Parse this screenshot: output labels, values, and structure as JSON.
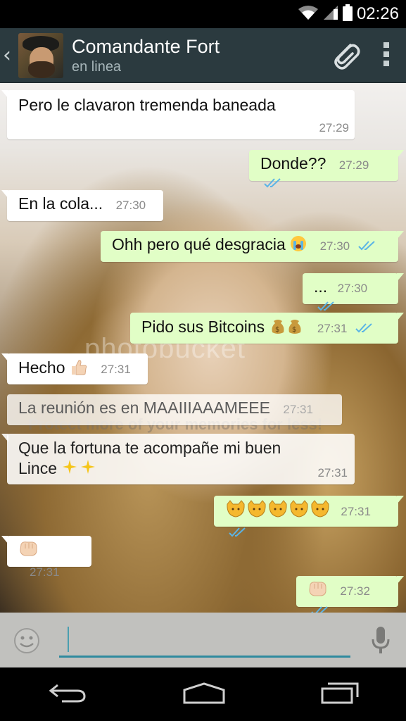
{
  "status_bar": {
    "time": "02:26"
  },
  "header": {
    "back": "‹",
    "contact_name": "Comandante Fort",
    "contact_status": "en linea"
  },
  "watermark": {
    "brand": "photobucket",
    "tagline": "Protect more of your memories for less!"
  },
  "messages": [
    {
      "dir": "in",
      "text": "Pero le clavaron tremenda baneada",
      "time": "27:29"
    },
    {
      "dir": "out",
      "text": "Donde??",
      "time": "27:29"
    },
    {
      "dir": "in",
      "text": "En la cola...",
      "time": "27:30"
    },
    {
      "dir": "out",
      "text": "Ohh pero qué desgracia",
      "emoji": "crying-face",
      "time": "27:30"
    },
    {
      "dir": "out",
      "text": "...",
      "time": "27:30"
    },
    {
      "dir": "out",
      "text": "Pido sus Bitcoins",
      "emoji": "money-bags",
      "time": "27:31"
    },
    {
      "dir": "in",
      "text": "Hecho",
      "emoji": "thumbs-up",
      "time": "27:31"
    },
    {
      "dir": "in",
      "text": "La reunión es en MAAIIIAAAMEEE",
      "time": "27:31"
    },
    {
      "dir": "in",
      "text": "Que la fortuna te acompañe mi buen",
      "text2": "Lince",
      "emoji": "sparkles",
      "time": "27:31"
    },
    {
      "dir": "out",
      "text": "",
      "emoji": "smiling-cat-faces",
      "time": "27:31"
    },
    {
      "dir": "in",
      "text": "",
      "emoji": "fist-bump",
      "time": "27:31"
    },
    {
      "dir": "out",
      "text": "",
      "emoji": "fist-bump",
      "time": "27:32"
    }
  ],
  "composer": {
    "value": "",
    "placeholder": ""
  },
  "icons": {
    "attach": "paperclip-icon",
    "menu": "overflow-menu-icon",
    "emoji": "smiley-icon",
    "mic": "microphone-icon",
    "nav_back": "back-icon",
    "nav_home": "home-icon",
    "nav_recents": "recents-icon"
  },
  "colors": {
    "action_bar": "#2b3a3f",
    "outgoing_bubble": "#e1fec6",
    "incoming_bubble": "#ffffff",
    "read_ticks": "#5ab4e6",
    "input_underline": "#2f8a9e"
  }
}
